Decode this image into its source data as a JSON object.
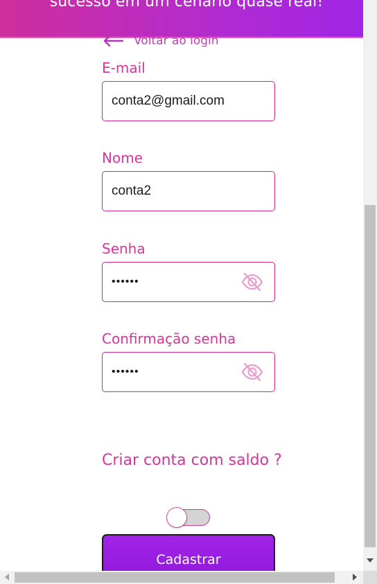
{
  "header": {
    "text": "sucesso em um cenário quase real!"
  },
  "back": {
    "label": "Voltar ao login",
    "icon": "arrow-left-icon"
  },
  "fields": {
    "email": {
      "label": "E-mail",
      "value": "conta2@gmail.com"
    },
    "name": {
      "label": "Nome",
      "value": "conta2"
    },
    "password": {
      "label": "Senha",
      "value": "••••••",
      "icon": "eye-off-icon"
    },
    "confirm": {
      "label": "Confirmação senha",
      "value": "••••••",
      "icon": "eye-off-icon"
    }
  },
  "balance": {
    "question": "Criar conta com saldo ?",
    "toggle_on": false
  },
  "submit": {
    "label": "Cadastrar"
  },
  "colors": {
    "accent": "#d3379a",
    "button": "#9c22e4",
    "header_start": "#cf2f9c",
    "header_end": "#9f25e6"
  }
}
